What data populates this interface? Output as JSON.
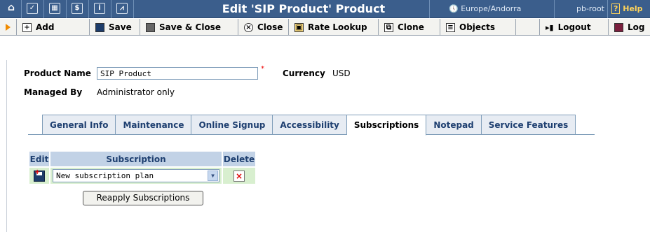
{
  "window": {
    "title": "Edit 'SIP Product' Product",
    "timezone": "Europe/Andorra",
    "user": "pb-root",
    "help": "Help"
  },
  "topbar_icons": [
    "home-icon",
    "checkbox-icon",
    "grid-icon",
    "dollar-icon",
    "info-icon",
    "chart-icon"
  ],
  "toolbar": {
    "add": "Add",
    "save": "Save",
    "save_close": "Save & Close",
    "close": "Close",
    "rate_lookup": "Rate Lookup",
    "clone": "Clone",
    "objects": "Objects",
    "logout": "Logout",
    "log": "Log"
  },
  "product": {
    "name_label": "Product Name",
    "name_value": "SIP Product",
    "currency_label": "Currency",
    "currency_value": "USD",
    "managed_label": "Managed By",
    "managed_value": "Administrator only"
  },
  "tabs": [
    {
      "label": "General Info",
      "active": false
    },
    {
      "label": "Maintenance",
      "active": false
    },
    {
      "label": "Online Signup",
      "active": false
    },
    {
      "label": "Accessibility",
      "active": false
    },
    {
      "label": "Subscriptions",
      "active": true
    },
    {
      "label": "Notepad",
      "active": false
    },
    {
      "label": "Service Features",
      "active": false
    }
  ],
  "subscriptions": {
    "headers": {
      "edit": "Edit",
      "subscription": "Subscription",
      "delete": "Delete"
    },
    "row": {
      "selected": "New subscription plan",
      "delete_mark": "×"
    },
    "reapply_label": "Reapply Subscriptions"
  }
}
